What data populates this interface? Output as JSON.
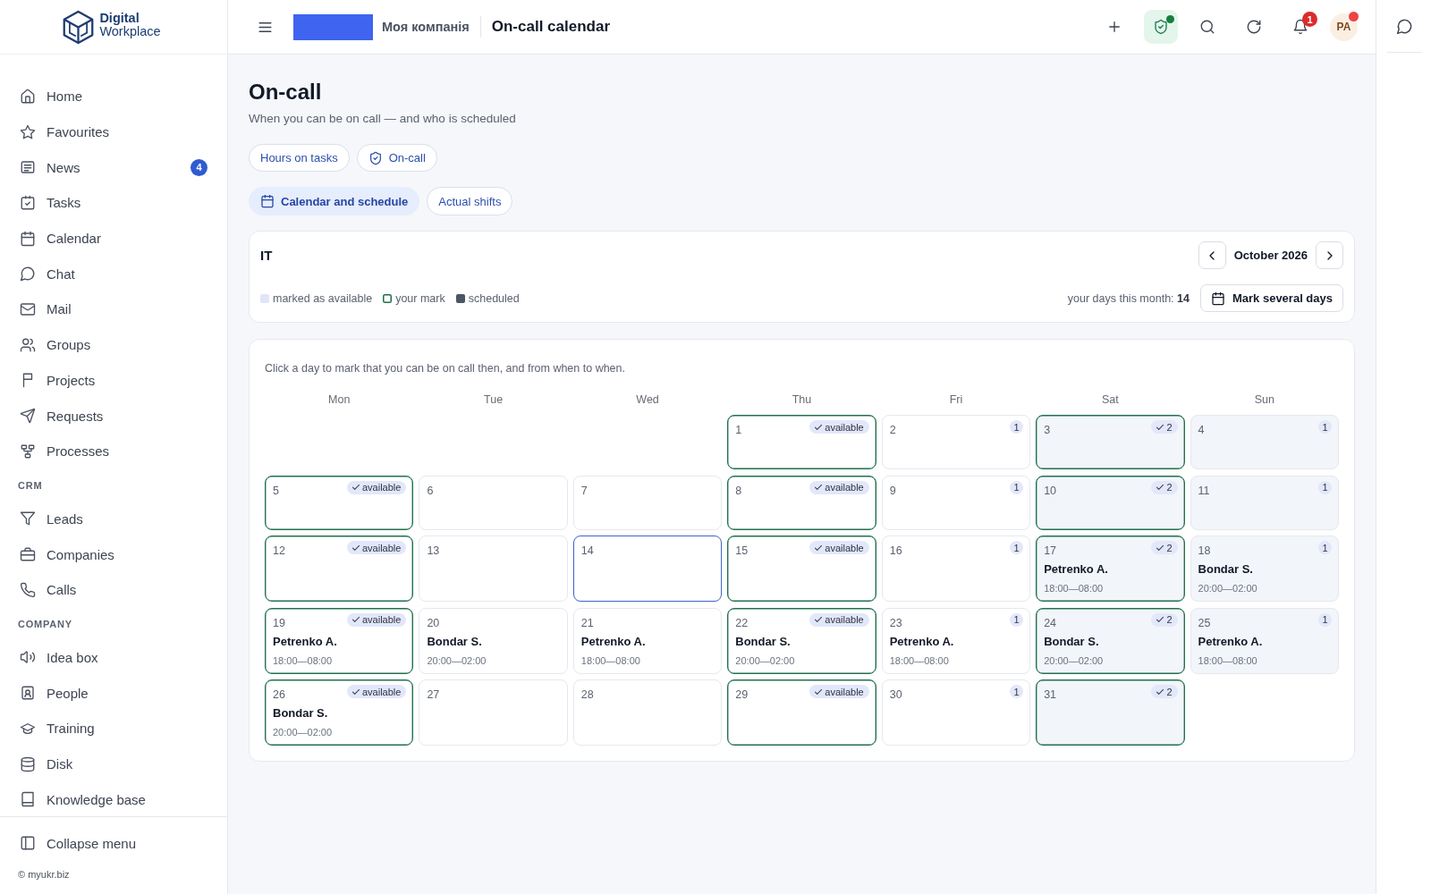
{
  "sidebar": {
    "brand": {
      "first": "Digital",
      "second": "Workplace"
    },
    "sections": [
      {
        "items": [
          {
            "label": "Home",
            "selected": false
          },
          {
            "label": "Favourites",
            "selected": false
          },
          {
            "label": "News",
            "selected": false,
            "count": "4"
          },
          {
            "label": "Tasks",
            "selected": false
          },
          {
            "label": "Calendar",
            "selected": false
          },
          {
            "label": "Chat",
            "selected": false
          },
          {
            "label": "Mail",
            "selected": false
          },
          {
            "label": "Groups",
            "selected": false
          },
          {
            "label": "Projects",
            "selected": false
          },
          {
            "label": "Requests",
            "selected": false
          },
          {
            "label": "Processes",
            "selected": false
          }
        ]
      },
      {
        "title": "CRM",
        "items": [
          {
            "label": "Leads",
            "selected": false
          },
          {
            "label": "Companies",
            "selected": false
          },
          {
            "label": "Calls",
            "selected": false
          }
        ]
      },
      {
        "title": "COMPANY",
        "items": [
          {
            "label": "Idea box",
            "selected": false
          },
          {
            "label": "People",
            "selected": false
          },
          {
            "label": "Training",
            "selected": false
          },
          {
            "label": "Disk",
            "selected": false
          },
          {
            "label": "Knowledge base",
            "selected": false
          }
        ]
      }
    ],
    "collapse": "Collapse menu",
    "copyright": "© myukr.biz"
  },
  "topbar": {
    "company": "Моя компанія",
    "title": "On-call calendar",
    "shield_alert": true,
    "notifications": "1",
    "avatar": "PA",
    "avatar_alert": true
  },
  "page": {
    "title": "On-call",
    "subtitle": "When you can be on call — and who is scheduled",
    "nav_tabs": [
      {
        "label": "Hours on tasks",
        "selected": false
      },
      {
        "label": "On-call",
        "selected": false
      }
    ],
    "view_tabs": [
      {
        "label": "Calendar and schedule",
        "selected": true
      },
      {
        "label": "Actual shifts",
        "selected": false
      }
    ]
  },
  "team": {
    "name": "IT",
    "month": "October 2026",
    "legend": [
      {
        "label": "marked as available",
        "kind": "fill",
        "color": "#e0e5fb"
      },
      {
        "label": "your mark",
        "kind": "outline",
        "color": "#1f6e4e"
      },
      {
        "label": "scheduled",
        "kind": "fill",
        "color": "#4b5565"
      }
    ],
    "summary": "your days this month: **14**",
    "action": "Mark several days"
  },
  "calendar": {
    "hint": "Click a day to mark that you can be on call then, and from when to when.",
    "weekdays": [
      "Mon",
      "Tue",
      "Wed",
      "Thu",
      "Fri",
      "Sat",
      "Sun"
    ],
    "days": [
      {
        "kind": "blank"
      },
      {
        "kind": "blank"
      },
      {
        "kind": "blank"
      },
      {
        "kind": "day",
        "number": "1",
        "marked": true,
        "today": false,
        "weekend": false,
        "badge": "available"
      },
      {
        "kind": "day",
        "number": "2",
        "marked": false,
        "today": false,
        "weekend": false,
        "badge": "1"
      },
      {
        "kind": "day",
        "number": "3",
        "marked": true,
        "today": false,
        "weekend": true,
        "badge": "2"
      },
      {
        "kind": "day",
        "number": "4",
        "marked": false,
        "today": false,
        "weekend": true,
        "badge": "1"
      },
      {
        "kind": "day",
        "number": "5",
        "marked": true,
        "today": false,
        "weekend": false,
        "badge": "available"
      },
      {
        "kind": "day",
        "number": "6",
        "marked": false,
        "today": false,
        "weekend": false
      },
      {
        "kind": "day",
        "number": "7",
        "marked": false,
        "today": false,
        "weekend": false
      },
      {
        "kind": "day",
        "number": "8",
        "marked": true,
        "today": false,
        "weekend": false,
        "badge": "available"
      },
      {
        "kind": "day",
        "number": "9",
        "marked": false,
        "today": false,
        "weekend": false,
        "badge": "1"
      },
      {
        "kind": "day",
        "number": "10",
        "marked": true,
        "today": false,
        "weekend": true,
        "badge": "2"
      },
      {
        "kind": "day",
        "number": "11",
        "marked": false,
        "today": false,
        "weekend": true,
        "badge": "1"
      },
      {
        "kind": "day",
        "number": "12",
        "marked": true,
        "today": false,
        "weekend": false,
        "badge": "available"
      },
      {
        "kind": "day",
        "number": "13",
        "marked": false,
        "today": false,
        "weekend": false
      },
      {
        "kind": "day",
        "number": "14",
        "marked": false,
        "today": true,
        "weekend": false
      },
      {
        "kind": "day",
        "number": "15",
        "marked": true,
        "today": false,
        "weekend": false,
        "badge": "available"
      },
      {
        "kind": "day",
        "number": "16",
        "marked": false,
        "today": false,
        "weekend": false,
        "badge": "1"
      },
      {
        "kind": "day",
        "number": "17",
        "marked": true,
        "today": false,
        "weekend": true,
        "badge": "2",
        "shift": {
          "person": "Petrenko A.",
          "time": "18:00—08:00"
        }
      },
      {
        "kind": "day",
        "number": "18",
        "marked": false,
        "today": false,
        "weekend": true,
        "badge": "1",
        "shift": {
          "person": "Bondar S.",
          "time": "20:00—02:00"
        }
      },
      {
        "kind": "day",
        "number": "19",
        "marked": true,
        "today": false,
        "weekend": false,
        "badge": "available",
        "shift": {
          "person": "Petrenko A.",
          "time": "18:00—08:00"
        }
      },
      {
        "kind": "day",
        "number": "20",
        "marked": false,
        "today": false,
        "weekend": false,
        "shift": {
          "person": "Bondar S.",
          "time": "20:00—02:00"
        }
      },
      {
        "kind": "day",
        "number": "21",
        "marked": false,
        "today": false,
        "weekend": false,
        "shift": {
          "person": "Petrenko A.",
          "time": "18:00—08:00"
        }
      },
      {
        "kind": "day",
        "number": "22",
        "marked": true,
        "today": false,
        "weekend": false,
        "badge": "available",
        "shift": {
          "person": "Bondar S.",
          "time": "20:00—02:00"
        }
      },
      {
        "kind": "day",
        "number": "23",
        "marked": false,
        "today": false,
        "weekend": false,
        "badge": "1",
        "shift": {
          "person": "Petrenko A.",
          "time": "18:00—08:00"
        }
      },
      {
        "kind": "day",
        "number": "24",
        "marked": true,
        "today": false,
        "weekend": true,
        "badge": "2",
        "shift": {
          "person": "Bondar S.",
          "time": "20:00—02:00"
        }
      },
      {
        "kind": "day",
        "number": "25",
        "marked": false,
        "today": false,
        "weekend": true,
        "badge": "1",
        "shift": {
          "person": "Petrenko A.",
          "time": "18:00—08:00"
        }
      },
      {
        "kind": "day",
        "number": "26",
        "marked": true,
        "today": false,
        "weekend": false,
        "badge": "available",
        "shift": {
          "person": "Bondar S.",
          "time": "20:00—02:00"
        }
      },
      {
        "kind": "day",
        "number": "27",
        "marked": false,
        "today": false,
        "weekend": false
      },
      {
        "kind": "day",
        "number": "28",
        "marked": false,
        "today": false,
        "weekend": false
      },
      {
        "kind": "day",
        "number": "29",
        "marked": true,
        "today": false,
        "weekend": false,
        "badge": "available"
      },
      {
        "kind": "day",
        "number": "30",
        "marked": false,
        "today": false,
        "weekend": false,
        "badge": "1"
      },
      {
        "kind": "day",
        "number": "31",
        "marked": true,
        "today": false,
        "weekend": true,
        "badge": "2"
      }
    ]
  }
}
